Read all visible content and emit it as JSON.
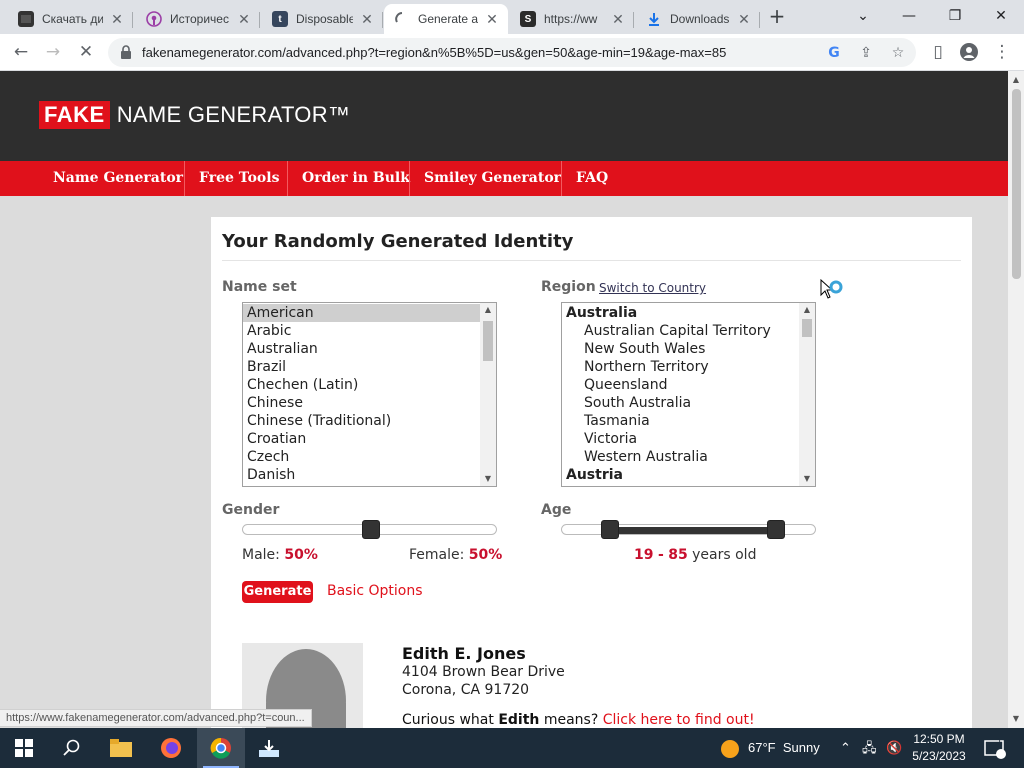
{
  "browser": {
    "tabs": [
      {
        "title": "Скачать ди",
        "favicon": "video-icon",
        "fav_color": "#333333"
      },
      {
        "title": "Историчес",
        "favicon": "podcast-icon",
        "fav_color": "#9b3ea6"
      },
      {
        "title": "Disposable",
        "favicon": "tumblr-icon",
        "fav_color": "#36465d"
      },
      {
        "title": "Generate a",
        "favicon": "loading-spinner-icon",
        "fav_color": "#5f6368"
      },
      {
        "title": "https://ww",
        "favicon": "s-logo-icon",
        "fav_color": "#2b2b2b"
      },
      {
        "title": "Downloads",
        "favicon": "download-icon",
        "fav_color": "#1a73e8"
      }
    ],
    "url": "fakenamegenerator.com/advanced.php?t=region&n%5B%5D=us&gen=50&age-min=19&age-max=85",
    "status_url": "https://www.fakenamegenerator.com/advanced.php?t=coun..."
  },
  "site": {
    "logo_fake": "FAKE",
    "logo_rest": "NAME GENERATOR™",
    "nav": [
      "Name Generator",
      "Free Tools",
      "Order in Bulk",
      "Smiley Generator",
      "FAQ"
    ]
  },
  "form": {
    "title": "Your Randomly Generated Identity",
    "name_set_label": "Name set",
    "name_sets": [
      "American",
      "Arabic",
      "Australian",
      "Brazil",
      "Chechen (Latin)",
      "Chinese",
      "Chinese (Traditional)",
      "Croatian",
      "Czech",
      "Danish"
    ],
    "selected_name_set": "American",
    "region_label": "Region",
    "switch_link": "Switch to Country",
    "regions": [
      {
        "label": "Australia",
        "kind": "group"
      },
      {
        "label": "Australian Capital Territory",
        "kind": "sub"
      },
      {
        "label": "New South Wales",
        "kind": "sub"
      },
      {
        "label": "Northern Territory",
        "kind": "sub"
      },
      {
        "label": "Queensland",
        "kind": "sub"
      },
      {
        "label": "South Australia",
        "kind": "sub"
      },
      {
        "label": "Tasmania",
        "kind": "sub"
      },
      {
        "label": "Victoria",
        "kind": "sub"
      },
      {
        "label": "Western Australia",
        "kind": "sub"
      },
      {
        "label": "Austria",
        "kind": "group"
      }
    ],
    "gender_label": "Gender",
    "male_label": "Male:",
    "male_pct": "50%",
    "female_label": "Female:",
    "female_pct": "50%",
    "gender_male_fraction": 0.5,
    "age_label": "Age",
    "age_min": "19",
    "age_sep": "-",
    "age_max": "85",
    "age_suffix": "years old",
    "generate_label": "Generate",
    "basic_options_label": "Basic Options"
  },
  "identity": {
    "name": "Edith E. Jones",
    "street": "4104 Brown Bear Drive",
    "city": "Corona, CA 91720",
    "curious_prefix": "Curious what",
    "first_name": "Edith",
    "curious_mid": "means?",
    "curious_link": "Click here to find out!"
  },
  "taskbar": {
    "weather_temp": "67°F",
    "weather_desc": "Sunny",
    "time": "12:50 PM",
    "date": "5/23/2023",
    "notification_count": "1"
  },
  "colors": {
    "brand_red": "#e0111b",
    "header_dark": "#2e2e2e"
  }
}
